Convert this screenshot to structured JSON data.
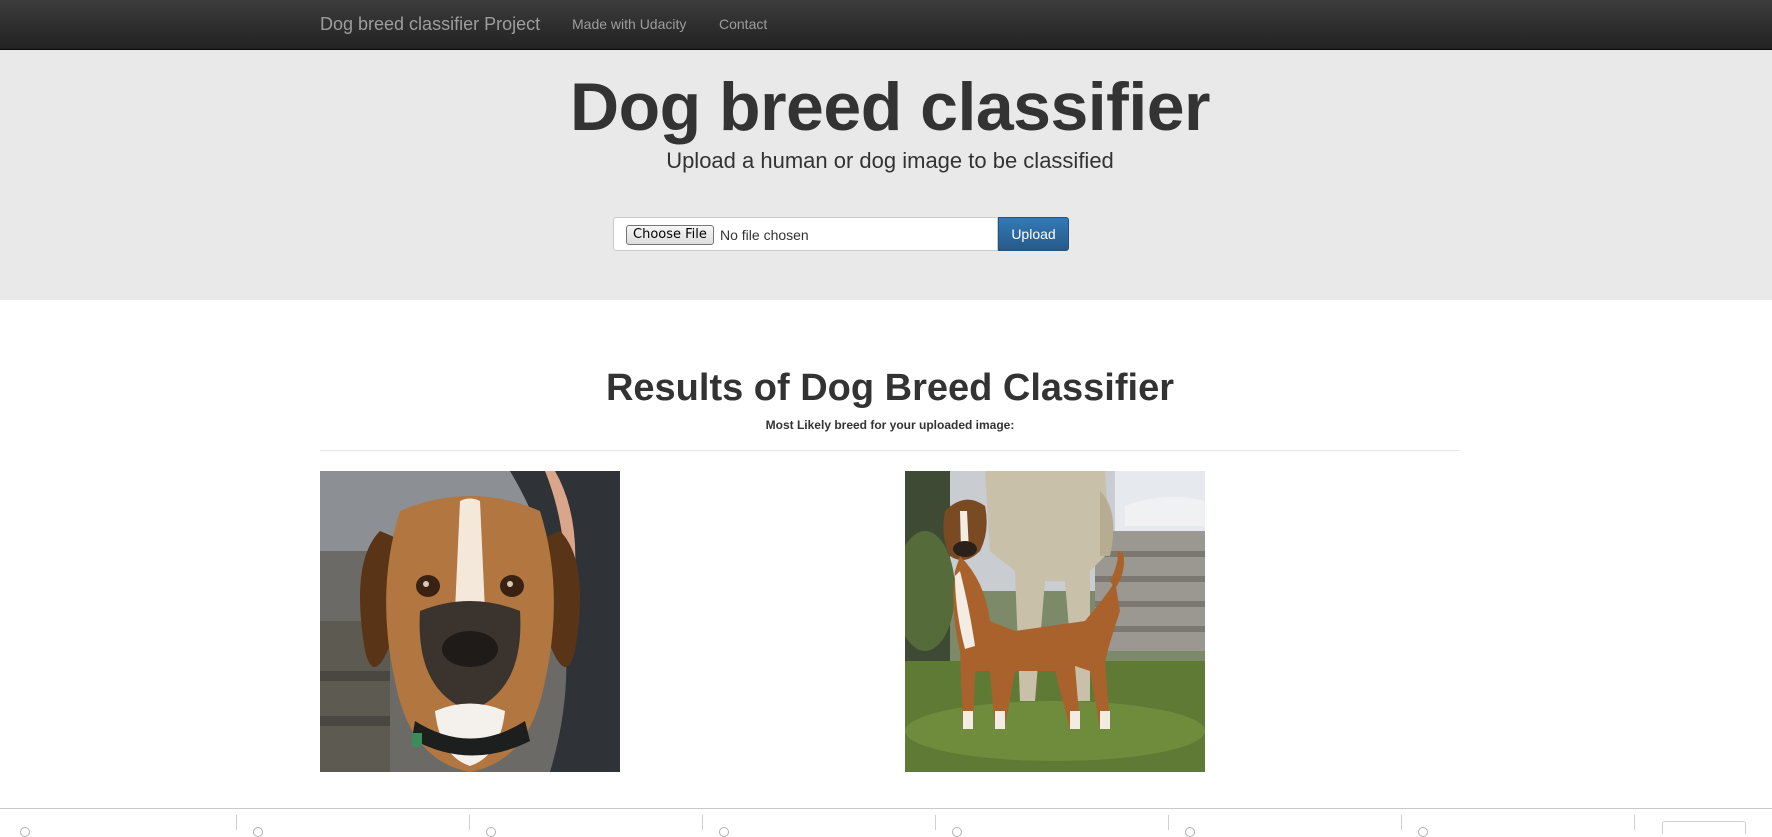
{
  "navbar": {
    "brand": "Dog breed classifier Project",
    "links": [
      "Made with Udacity",
      "Contact"
    ]
  },
  "hero": {
    "title": "Dog breed classifier",
    "subtitle": "Upload a human or dog image to be classified"
  },
  "upload_form": {
    "choose_label": "Choose File",
    "file_status": "No file chosen",
    "upload_label": "Upload"
  },
  "results": {
    "title": "Results of Dog Breed Classifier",
    "subtitle": "Most Likely breed for your uploaded image:"
  },
  "images": [
    {
      "name": "uploaded-image",
      "content": "close-up face of a boxer dog with dark collar"
    },
    {
      "name": "predicted-breed-image",
      "content": "boxer dog standing on grass beside a person"
    }
  ],
  "colors": {
    "navbar": "#222222",
    "jumbotron": "#e9e9e9",
    "primary_button": "#2e6da4"
  }
}
